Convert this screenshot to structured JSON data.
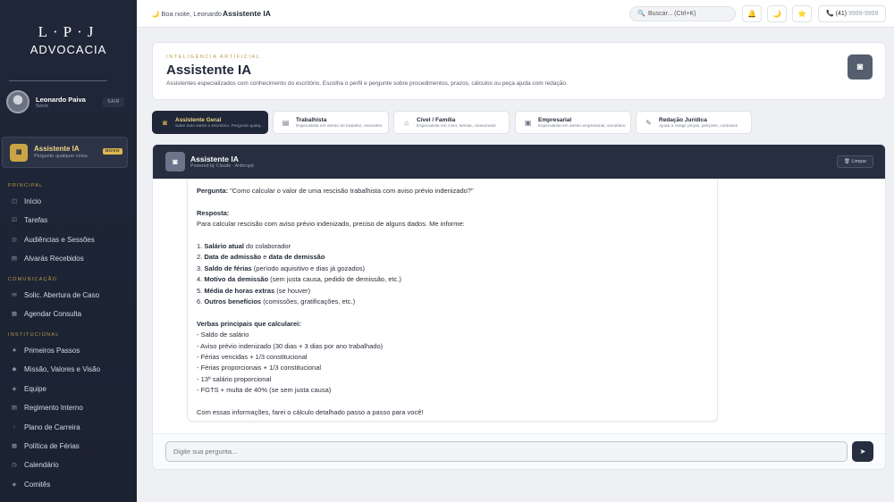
{
  "brand": {
    "line1": "L·P·J",
    "line2": "ADVOCACIA"
  },
  "user": {
    "name": "Leonardo Paiva",
    "role": "Sócio",
    "logout_label": "SAIR"
  },
  "ai_card": {
    "title": "Assistente IA",
    "subtitle": "Pergunte qualquer coisa",
    "badge": "NOVO"
  },
  "sidebar": {
    "sections": [
      {
        "title": "PRINCIPAL",
        "items": [
          {
            "label": "Início",
            "icon": "◫"
          },
          {
            "label": "Tarefas",
            "icon": "☑"
          },
          {
            "label": "Audiências e Sessões",
            "icon": "◎"
          },
          {
            "label": "Alvarás Recebidos",
            "icon": "▤"
          }
        ]
      },
      {
        "title": "COMUNICAÇÃO",
        "items": [
          {
            "label": "Solic. Abertura de Caso",
            "icon": "✉"
          },
          {
            "label": "Agendar Consulta",
            "icon": "▦"
          }
        ]
      },
      {
        "title": "INSTITUCIONAL",
        "items": [
          {
            "label": "Primeiros Passos",
            "icon": "★"
          },
          {
            "label": "Missão, Valores e Visão",
            "icon": "◆"
          },
          {
            "label": "Equipe",
            "icon": "◈"
          },
          {
            "label": "Regimento Interno",
            "icon": "▤"
          },
          {
            "label": "Plano de Carreira",
            "icon": "↑"
          },
          {
            "label": "Política de Férias",
            "icon": "▦"
          },
          {
            "label": "Calendário",
            "icon": "◷"
          },
          {
            "label": "Comitês",
            "icon": "◈"
          }
        ]
      }
    ]
  },
  "header": {
    "greeting": "🌙 Boa noite, Leonardo",
    "separator": "›",
    "breadcrumb": "Assistente IA",
    "search_placeholder": "Buscar... (Ctrl+K)",
    "phone_prefix": "(41)",
    "phone_number": "9999-9999"
  },
  "hero": {
    "kicker": "INTELIGÊNCIA ARTIFICIAL",
    "title": "Assistente IA",
    "description": "Assistentes especializados com conhecimento do escritório. Escolha o perfil e pergunte sobre procedimentos, prazos, cálculos ou peça ajuda com redação."
  },
  "profiles": [
    {
      "title": "Assistente Geral",
      "subtitle": "Sabe tudo sobre o escritório. Pergunte qualquer coisa",
      "icon": "◙",
      "active": true
    },
    {
      "title": "Trabalhista",
      "subtitle": "Especialista em direito do trabalho, rescisões",
      "icon": "▤",
      "active": false
    },
    {
      "title": "Cível / Família",
      "subtitle": "Especialista em cível, família, consumidor",
      "icon": "⌂",
      "active": false
    },
    {
      "title": "Empresarial",
      "subtitle": "Especialista em direito empresarial, societário",
      "icon": "▣",
      "active": false
    },
    {
      "title": "Redação Jurídica",
      "subtitle": "Ajuda a redigir peças, petições, contratos",
      "icon": "✎",
      "active": false
    }
  ],
  "chat": {
    "title": "Assistente IA",
    "subtitle": "Powered by Claude - Anthropic",
    "clear_label": "🗑 Limpar",
    "input_placeholder": "Digite sua pergunta...",
    "send_icon": "➤",
    "message": {
      "question_label": "Pergunta:",
      "question": " \"Como calcular o valor de uma rescisão trabalhista com aviso prévio indenizado?\"",
      "answer_label": "Resposta:",
      "intro": "Para calcular rescisão com aviso prévio indenizado, preciso de alguns dados. Me informe:",
      "items": [
        {
          "n": "1. ",
          "b": "Salário atual",
          "rest": " do colaborador"
        },
        {
          "n": "2. ",
          "b": "Data de admissão",
          "mid": " e ",
          "b2": "data de demissão",
          "rest": ""
        },
        {
          "n": "3. ",
          "b": "Saldo de férias",
          "rest": " (período aquisitivo e dias já gozados)"
        },
        {
          "n": "4. ",
          "b": "Motivo da demissão",
          "rest": " (sem justa causa, pedido de demissão, etc.)"
        },
        {
          "n": "5. ",
          "b": "Média de horas extras",
          "rest": " (se houver)"
        },
        {
          "n": "6. ",
          "b": "Outros benefícios",
          "rest": " (comissões, gratificações, etc.)"
        }
      ],
      "list_title": "Verbas principais que calcularei:",
      "verbas": [
        "- Saldo de salário",
        "- Aviso prévio indenizado (30 dias + 3 dias por ano trabalhado)",
        "- Férias vencidas + 1/3 constitucional",
        "- Férias proporcionais + 1/3 constitucional",
        "- 13º salário proporcional",
        "- FGTS + multa de 40% (se sem justa causa)"
      ],
      "closing": "Com essas informações, farei o cálculo detalhado passo a passo para você!"
    }
  },
  "colors": {
    "sidebar_bg": "#1f2738",
    "accent_gold": "#c9a545",
    "chat_header": "#262e3f"
  }
}
